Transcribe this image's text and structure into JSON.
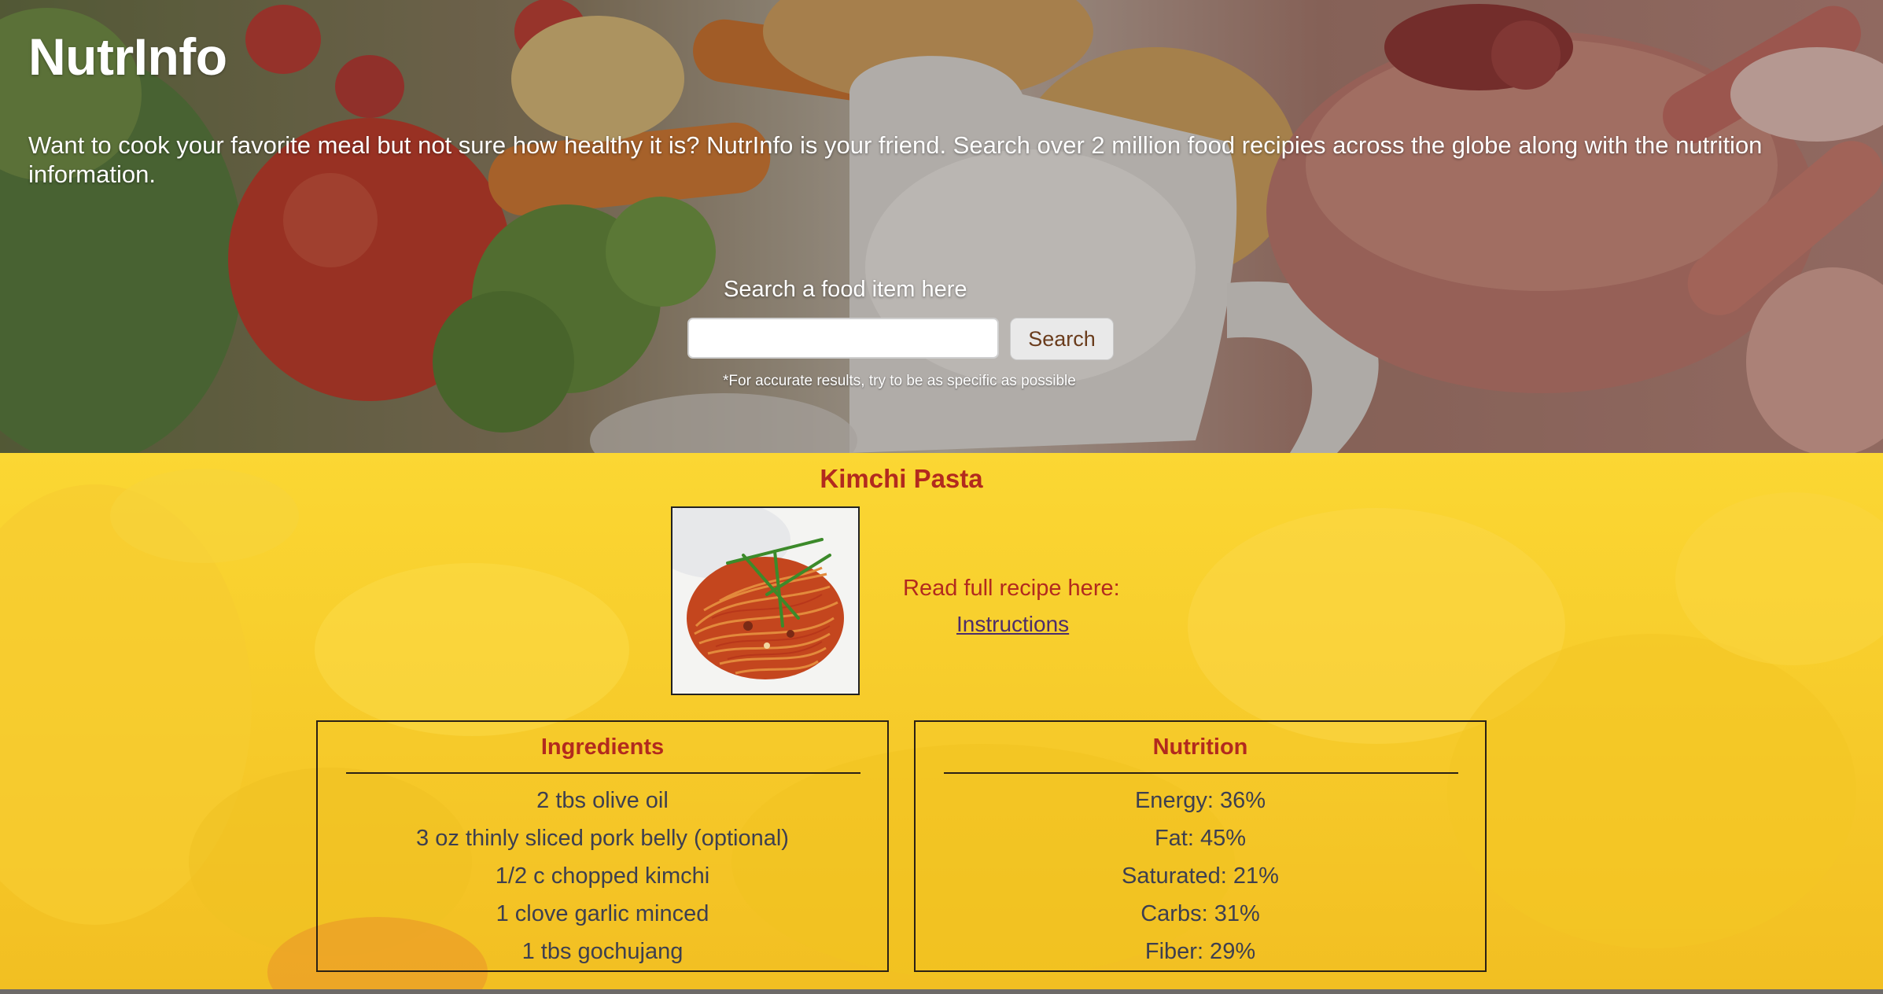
{
  "header": {
    "brand": "NutrInfo",
    "tagline": "Want to cook your favorite meal but not sure how healthy it is? NutrInfo is your friend. Search over 2 million food recipies across the globe along with the nutrition information."
  },
  "search": {
    "label": "Search a food item here",
    "value": "",
    "placeholder": "",
    "button_label": "Search",
    "note": "*For accurate results, try to be as specific as possible"
  },
  "recipe": {
    "title": "Kimchi Pasta",
    "read_full_label": "Read full recipe here:",
    "instructions_link": "Instructions"
  },
  "ingredients": {
    "title": "Ingredients",
    "items": [
      "2 tbs olive oil",
      "3 oz thinly sliced pork belly (optional)",
      "1/2 c chopped kimchi",
      "1 clove garlic minced",
      "1 tbs gochujang"
    ]
  },
  "nutrition": {
    "title": "Nutrition",
    "items": [
      "Energy: 36%",
      "Fat: 45%",
      "Saturated: 21%",
      "Carbs: 31%",
      "Fiber: 29%"
    ]
  },
  "colors": {
    "accent_red": "#b22a1e",
    "result_yellow": "#f7cf2a",
    "link_purple": "#4d2d6b",
    "body_text": "#3d3f50"
  }
}
